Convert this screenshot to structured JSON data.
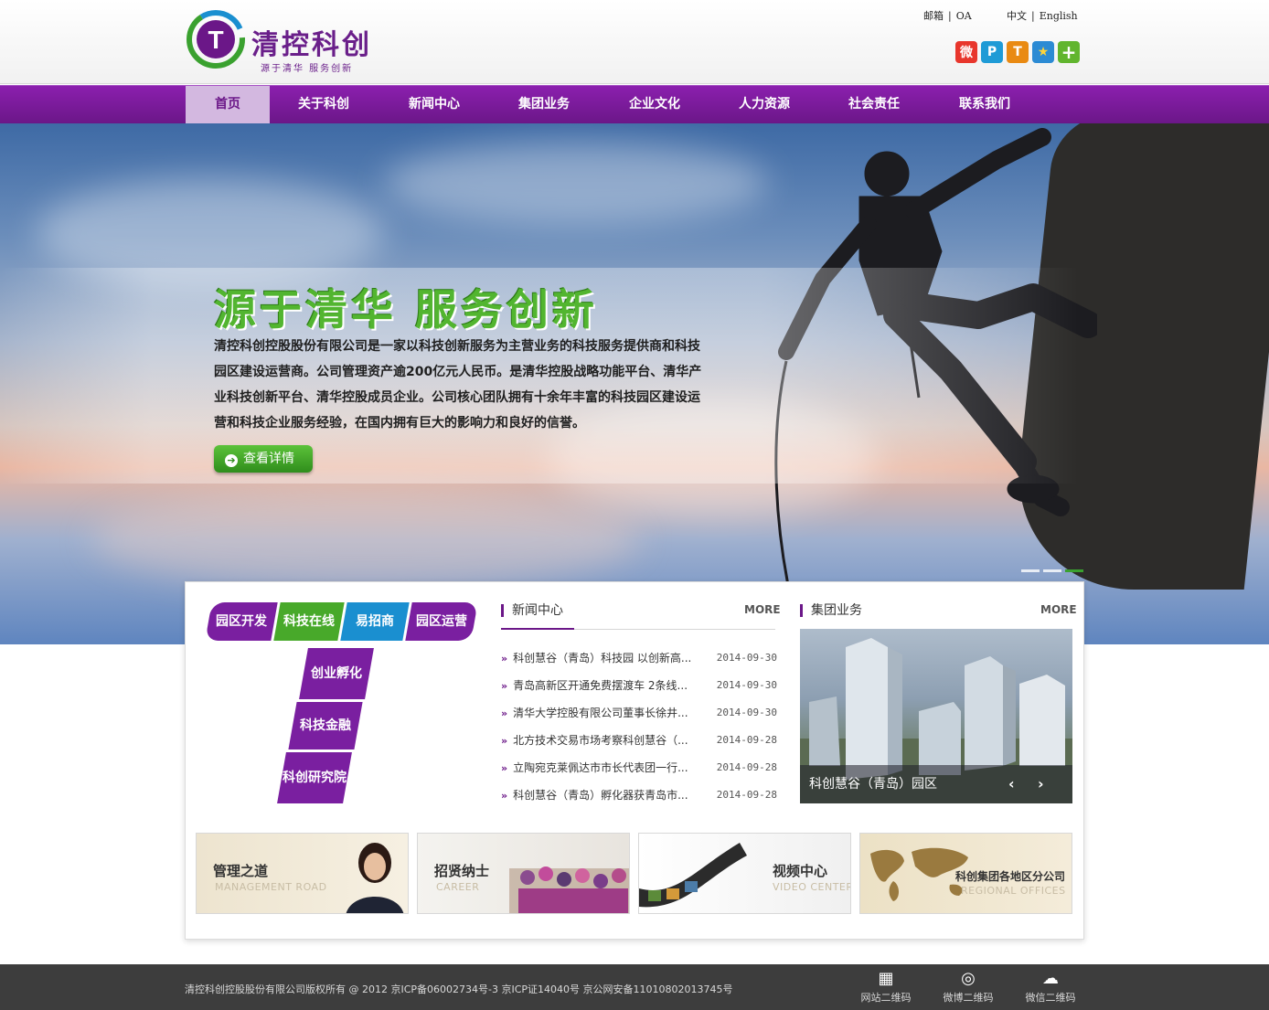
{
  "header": {
    "logo_title": "清控科创",
    "logo_sub": "源于清华  服务创新",
    "links_left": [
      "邮箱",
      "OA"
    ],
    "links_right": [
      "中文",
      "English"
    ],
    "social": [
      {
        "icon": "weibo-icon",
        "color": "#e8362c",
        "glyph": "微"
      },
      {
        "icon": "pinterest-icon",
        "color": "#1f9bd6",
        "glyph": "P"
      },
      {
        "icon": "tencent-weibo-icon",
        "color": "#e98a12",
        "glyph": "T"
      },
      {
        "icon": "qzone-icon",
        "color": "#2c8bd4",
        "glyph": "★"
      },
      {
        "icon": "plus-share-icon",
        "color": "#61b52e",
        "glyph": "+"
      }
    ]
  },
  "nav": [
    "首页",
    "关于科创",
    "新闻中心",
    "集团业务",
    "企业文化",
    "人力资源",
    "社会责任",
    "联系我们"
  ],
  "banner": {
    "slogan": "源于清华  服务创新",
    "intro": "清控科创控股股份有限公司是一家以科技创新服务为主营业务的科技服务提供商和科技园区建设运营商。公司管理资产逾200亿元人民币。是清华控股战略功能平台、清华产业科技创新平台、清华控股成员企业。公司核心团队拥有十余年丰富的科技园区建设运营和科技企业服务经验，在国内拥有巨大的影响力和良好的信誉。",
    "button": "查看详情"
  },
  "services": {
    "top": [
      "园区开发",
      "科技在线",
      "易招商",
      "园区运营"
    ],
    "stem": [
      "创业孵化",
      "科技金融",
      "科创研究院"
    ]
  },
  "news": {
    "title": "新闻中心",
    "more": "MORE",
    "items": [
      {
        "title": "科创慧谷（青岛）科技园 以创新高...",
        "date": "2014-09-30"
      },
      {
        "title": "青岛高新区开通免费摆渡车 2条线...",
        "date": "2014-09-30"
      },
      {
        "title": "清华大学控股有限公司董事长徐井...",
        "date": "2014-09-30"
      },
      {
        "title": "北方技术交易市场考察科创慧谷（...",
        "date": "2014-09-28"
      },
      {
        "title": "立陶宛克莱佩达市市长代表团一行...",
        "date": "2014-09-28"
      },
      {
        "title": "科创慧谷（青岛）孵化器获青岛市...",
        "date": "2014-09-28"
      }
    ]
  },
  "business": {
    "title": "集团业务",
    "more": "MORE",
    "caption": "科创慧谷（青岛）园区"
  },
  "cards": [
    {
      "title": "管理之道",
      "sub": "MANAGEMENT ROAD"
    },
    {
      "title": "招贤纳士",
      "sub": "CAREER"
    },
    {
      "title": "视频中心",
      "sub": "VIDEO CENTER"
    },
    {
      "title": "科创集团各地区分公司",
      "sub": "REGIONAL OFFICES"
    }
  ],
  "footer": {
    "copyright": "清控科创控股股份有限公司版权所有 @ 2012 京ICP备06002734号-3 京ICP证14040号 京公网安备11010802013745号",
    "items": [
      {
        "icon": "qr-code-icon",
        "label": "网站二维码"
      },
      {
        "icon": "weibo-icon",
        "label": "微博二维码"
      },
      {
        "icon": "wechat-icon",
        "label": "微信二维码"
      }
    ]
  },
  "colors": {
    "brand_purple": "#6b1788",
    "brand_green": "#3aa12f",
    "blue_block": "#1a8fd0"
  }
}
